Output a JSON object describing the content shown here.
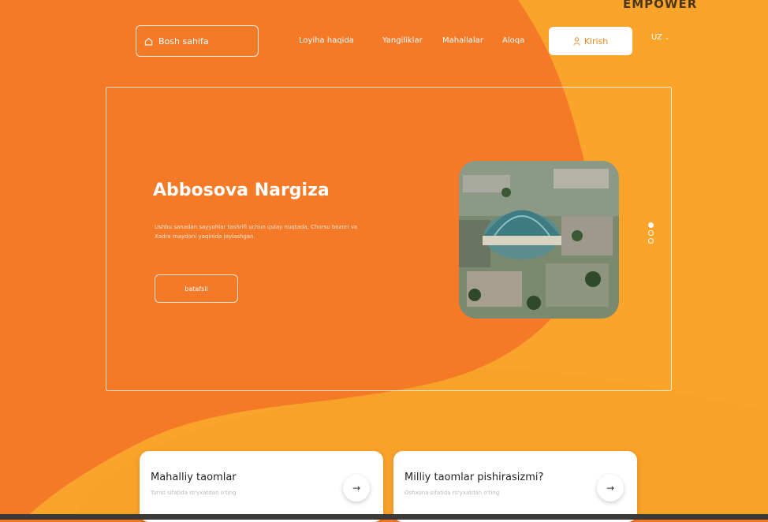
{
  "header": {
    "home_label": "Bosh sahifa",
    "nav": [
      "Loyiha haqida",
      "Yangiliklar",
      "Mahallalar",
      "Aloqa"
    ],
    "login_label": "Kirish",
    "language": "UZ",
    "watermark": "EMPOWER"
  },
  "hero": {
    "title": "Abbosova Nargiza",
    "description": "Ushbu sanadan sayyohlar tashrifi uchun qulay nuqtada, Chorsu bozori va Xadra maydoni yaqinida joylashgan.",
    "button_label": "batafsil",
    "slides_total": 3,
    "active_slide": 1
  },
  "cards": [
    {
      "title": "Mahalliy taomlar",
      "subtitle": "Turist sifatida ro'yxatdan o'ting"
    },
    {
      "title": "Milliy taomlar pishirasizmi?",
      "subtitle": "Oshxona sifatida ro'yxatdan o'ting"
    }
  ],
  "colors": {
    "orange_dark": "#f47a28",
    "orange_light": "#fba42b",
    "accent_text": "#f0891e"
  }
}
